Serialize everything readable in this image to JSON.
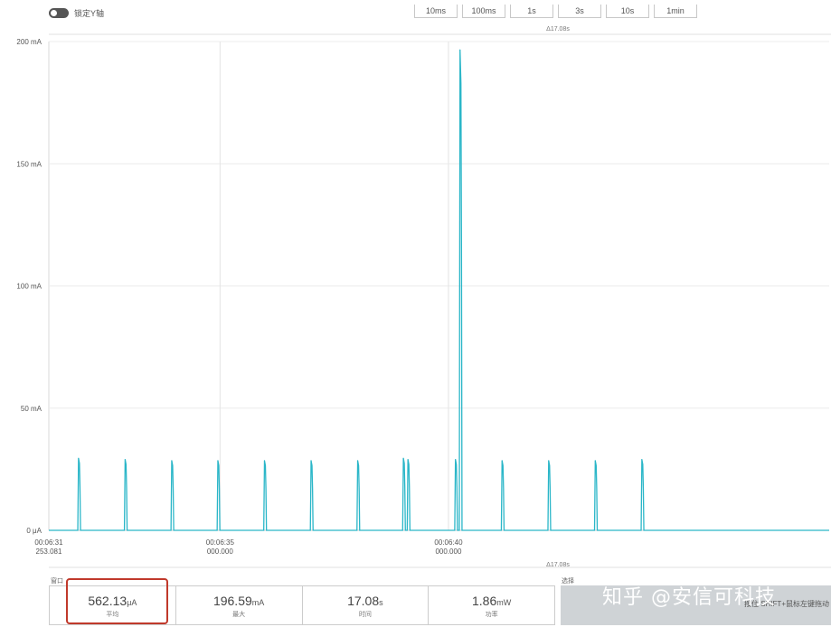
{
  "lock_y_label": "锁定Y轴",
  "ranges": [
    "10ms",
    "100ms",
    "1s",
    "3s",
    "10s",
    "1min"
  ],
  "delta_label": "Δ17.08s",
  "window_label": "窗口",
  "selection_label": "选择",
  "selection_hint": "按住 SHIFT+鼠标左键拖动",
  "watermark": "知乎 @安信可科技",
  "stats": [
    {
      "value": "562.13",
      "unit": "μA",
      "label": "平均"
    },
    {
      "value": "196.59",
      "unit": "mA",
      "label": "最大"
    },
    {
      "value": "17.08",
      "unit": "s",
      "label": "时间"
    },
    {
      "value": "1.86",
      "unit": "mW",
      "label": "功率"
    }
  ],
  "chart_data": {
    "type": "line",
    "y_ticks": [
      "0 μA",
      "50 mA",
      "100 mA",
      "150 mA",
      "200 mA"
    ],
    "y_tick_values": [
      0,
      50,
      100,
      150,
      200
    ],
    "ylim": [
      0,
      200
    ],
    "x_range_s": [
      0,
      17.08
    ],
    "x_ticks": [
      {
        "t": 0,
        "line1": "00:06:31",
        "line2": "253.081"
      },
      {
        "t": 3.747,
        "line1": "00:06:35",
        "line2": "000.000"
      },
      {
        "t": 8.747,
        "line1": "00:06:40",
        "line2": "000.000"
      }
    ],
    "grid": true,
    "series": [
      {
        "color": "#2ab6c8",
        "spikes": [
          {
            "t": 0.65,
            "peak": 29.5
          },
          {
            "t": 1.67,
            "peak": 29.0
          },
          {
            "t": 2.69,
            "peak": 28.5
          },
          {
            "t": 3.7,
            "peak": 28.5
          },
          {
            "t": 4.72,
            "peak": 28.5
          },
          {
            "t": 5.74,
            "peak": 28.5
          },
          {
            "t": 6.76,
            "peak": 28.5
          },
          {
            "t": 7.76,
            "peak": 29.5
          },
          {
            "t": 7.86,
            "peak": 29.0
          },
          {
            "t": 8.9,
            "peak": 29.0
          },
          {
            "t": 9.0,
            "peak": 196.59
          },
          {
            "t": 9.92,
            "peak": 28.5
          },
          {
            "t": 10.94,
            "peak": 28.5
          },
          {
            "t": 11.96,
            "peak": 28.5
          },
          {
            "t": 12.98,
            "peak": 29.0
          }
        ]
      }
    ]
  }
}
